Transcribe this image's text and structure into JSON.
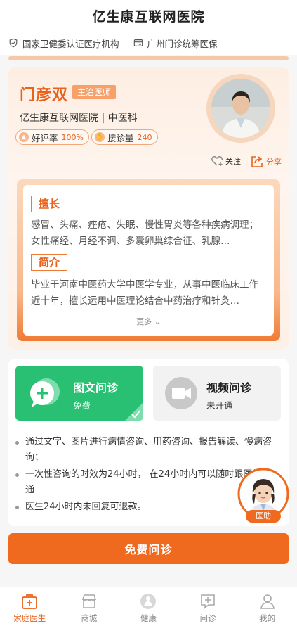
{
  "header": {
    "title": "亿生康互联网医院"
  },
  "certs": [
    {
      "label": "国家卫健委认证医疗机构",
      "icon": "shield-check-icon"
    },
    {
      "label": "广州门诊统筹医保",
      "icon": "card-icon"
    }
  ],
  "doctor": {
    "name": "门彦双",
    "title": "主治医师",
    "hospital_dept": "亿生康互联网医院 | 中医科",
    "rating_label": "好评率",
    "rating_value": "100%",
    "visits_label": "接诊量",
    "visits_value": "240",
    "follow_label": "关注",
    "share_label": "分享"
  },
  "profile": {
    "specialty_title": "擅长",
    "specialty_text": "感冒、头痛、痤疮、失眠、慢性胃炎等各种疾病调理；女性痛经、月经不调、多囊卵巢综合征、乳腺…",
    "intro_title": "简介",
    "intro_text": "毕业于河南中医药大学中医学专业，从事中医临床工作近十年，擅长运用中医理论结合中药治疗和针灸…",
    "more_label": "更多"
  },
  "consult": {
    "options": [
      {
        "name": "图文问诊",
        "sub": "免费",
        "selected": true
      },
      {
        "name": "视频问诊",
        "sub": "未开通",
        "selected": false
      }
    ],
    "notes": [
      "通过文字、图片进行病情咨询、用药咨询、报告解读、慢病咨询；",
      "一次性咨询的时效为24小时， 在24小时内可以随时跟医生沟通",
      "医生24小时内未回复可退款。"
    ],
    "helper_label": "医助",
    "cta_label": "免费问诊"
  },
  "tabs": [
    {
      "label": "家庭医生",
      "icon": "medical-kit-icon",
      "active": true
    },
    {
      "label": "商城",
      "icon": "store-icon",
      "active": false
    },
    {
      "label": "健康",
      "icon": "health-icon",
      "active": false
    },
    {
      "label": "问诊",
      "icon": "consult-icon",
      "active": false
    },
    {
      "label": "我的",
      "icon": "profile-icon",
      "active": false
    }
  ],
  "colors": {
    "accent": "#e8621b",
    "green": "#29c074",
    "cta": "#ef6a1f"
  }
}
